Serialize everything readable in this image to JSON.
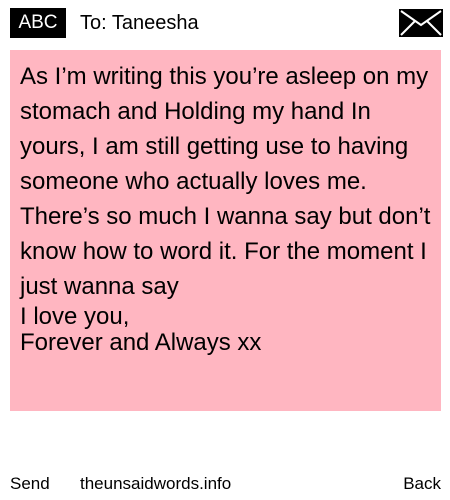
{
  "header": {
    "logo_text": "ABC",
    "recipient": "To: Taneesha",
    "envelope_icon": "envelope-icon"
  },
  "message": {
    "paragraph": "As I’m writing this you’re asleep on my stomach and Holding my hand In yours, I am still getting use to having someone who actually loves me. There’s so much I wanna say but don’t know how to word it. For the moment I just wanna say",
    "line_2": "I love you,",
    "line_3": "Forever and Always xx",
    "background_color": "#ffb6c1"
  },
  "footer": {
    "send_label": "Send",
    "site_label": "theunsaidwords.info",
    "back_label": "Back"
  }
}
